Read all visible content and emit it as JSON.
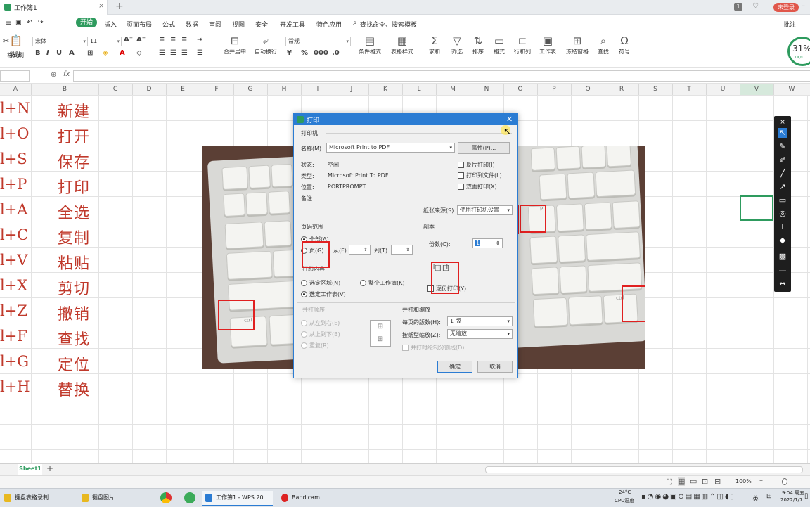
{
  "titlebar": {
    "doc_tab": "工作簿1",
    "close_glyph": "×",
    "add_tab": "+",
    "window_count": "1",
    "login_button": "未登录"
  },
  "menu": {
    "items": [
      "开始",
      "插入",
      "页面布局",
      "公式",
      "数据",
      "审阅",
      "视图",
      "安全",
      "开发工具",
      "特色应用"
    ],
    "search": "查找命令、搜索模板",
    "comments": "批注"
  },
  "ribbon": {
    "paste": "粘贴",
    "format_painter": "格式刷",
    "font_name": "宋体",
    "font_size": "11",
    "number_format": "常规",
    "merge_center": "合并居中",
    "wrap": "自动换行",
    "cond_format": "条件格式",
    "table_style": "表格样式",
    "sum": "求和",
    "filter": "筛选",
    "sort": "排序",
    "format": "格式",
    "rowcol": "行和列",
    "worksheet": "工作表",
    "freeze": "冻结窗格",
    "find": "查找",
    "symbol": "符号",
    "cpu_percent": "31%",
    "net_speed": "0K/s"
  },
  "formula": {
    "fx": "fx"
  },
  "columns": [
    "A",
    "B",
    "C",
    "D",
    "E",
    "F",
    "G",
    "H",
    "I",
    "J",
    "K",
    "L",
    "M",
    "N",
    "O",
    "P",
    "Q",
    "R",
    "S",
    "T",
    "U",
    "V",
    "W"
  ],
  "rows": [
    {
      "a": "l+N",
      "b": "新建"
    },
    {
      "a": "l+O",
      "b": "打开"
    },
    {
      "a": "l+S",
      "b": "保存"
    },
    {
      "a": "l+P",
      "b": "打印"
    },
    {
      "a": "l+A",
      "b": "全选"
    },
    {
      "a": "l+C",
      "b": "复制"
    },
    {
      "a": "l+V",
      "b": "粘贴"
    },
    {
      "a": "l+X",
      "b": "剪切"
    },
    {
      "a": "l+Z",
      "b": "撤销"
    },
    {
      "a": "l+F",
      "b": "查找"
    },
    {
      "a": "l+G",
      "b": "定位"
    },
    {
      "a": "l+H",
      "b": "替换"
    }
  ],
  "photo": {
    "keys": [
      "ctrl",
      "P",
      "ctrl"
    ]
  },
  "dialog": {
    "title": "打印",
    "printer_section": "打印机",
    "name_label": "名称(M):",
    "name_value": "Microsoft Print to PDF",
    "properties_button": "属性(P)...",
    "status_label": "状态:",
    "status_value": "空闲",
    "type_label": "类型:",
    "type_value": "Microsoft Print To PDF",
    "location_label": "位置:",
    "location_value": "PORTPROMPT:",
    "comment_label": "备注:",
    "reverse_print": "反片打印(I)",
    "print_to_file": "打印到文件(L)",
    "duplex": "双面打印(X)",
    "paper_source_label": "纸张来源(S):",
    "paper_source_value": "使用打印机设置",
    "page_range_section": "页码范围",
    "all_pages": "全部(A)",
    "pages": "页(G)",
    "from_label": "从(F):",
    "to_label": "到(T):",
    "copies_section": "副本",
    "copies_label": "份数(C):",
    "copies_value": "1",
    "collate": "逐份打印(Y)",
    "print_what_section": "打印内容",
    "selection": "选定区域(N)",
    "whole_workbook": "整个工作簿(K)",
    "active_sheet": "选定工作表(V)",
    "order_section": "并打顺序",
    "left_to_right": "从左到右(E)",
    "top_to_bottom": "从上到下(B)",
    "repeat": "重复(R)",
    "zoom_section": "并打和缩放",
    "pages_per_sheet_label": "每页的版数(H):",
    "pages_per_sheet_value": "1 版",
    "scale_label": "按纸型缩放(Z):",
    "scale_value": "无缩放",
    "draw_borders": "并打时绘制分割线(D)",
    "ok_button": "确定",
    "cancel_button": "取消"
  },
  "sheets": {
    "active": "Sheet1",
    "add": "+"
  },
  "status": {
    "zoom": "100%"
  },
  "taskbar": {
    "items": [
      "键盘表格录制",
      "键盘图片",
      "工作簿1 - WPS 20...",
      "Bandicam"
    ],
    "weather_temp": "24°C",
    "weather_label": "CPU温度",
    "lang": "英",
    "time": "9:04 周五",
    "date": "2022/1/7"
  }
}
